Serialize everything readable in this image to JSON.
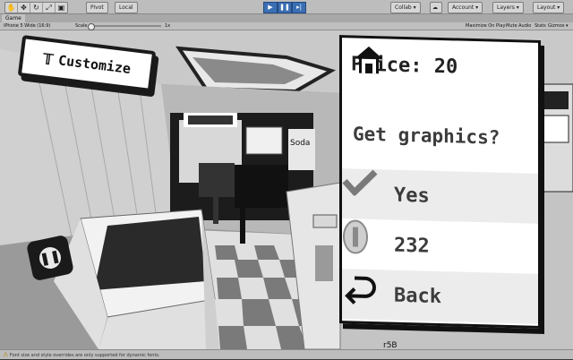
{
  "editor": {
    "toolbar": {
      "pivot_label": "Pivot",
      "local_label": "Local",
      "collab_label": "Collab ▾",
      "account_label": "Account ▾",
      "layers_label": "Layers ▾",
      "layout_label": "Layout ▾"
    },
    "game_tab": {
      "label": "Game"
    },
    "game_toolbar": {
      "resolution": "iPhone 5 Wide (16:9)",
      "scale_label": "Scale",
      "scale_value": "1x",
      "maximize_on_play": "Maximize On Play",
      "mute_audio": "Mute Audio",
      "stats": "Stats",
      "gizmos": "Gizmos ▾"
    },
    "status": {
      "message": "Font size and style overrides are only supported for dynamic fonts."
    }
  },
  "game": {
    "customize_label": "Customize",
    "pause_icon": "pause-icon",
    "sign_text": "Soda",
    "floor_text": "r5B",
    "panel": {
      "price_label": "Price: 20",
      "question": "Get graphics?",
      "yes_label": "Yes",
      "coin_count": "232",
      "back_label": "Back"
    }
  },
  "colors": {
    "accent": "#3b6fb3",
    "panel_border": "#111111",
    "panel_text": "#3c3c3c"
  }
}
